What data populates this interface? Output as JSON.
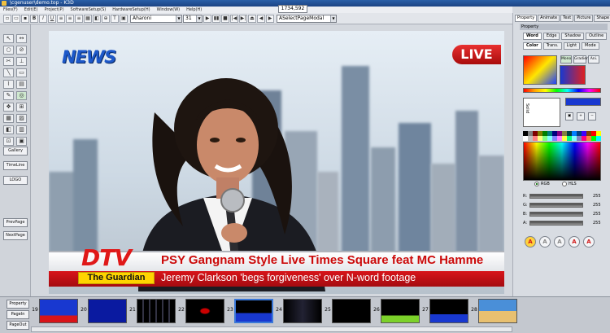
{
  "window": {
    "title": "\\cgenuser\\demo.top - K3D"
  },
  "coords_readout": "1734,592",
  "menu": [
    "Files(F)",
    "Edit(E)",
    "Project(P)",
    "SoftwareSetup(S)",
    "HardwareSetup(H)",
    "Window(W)",
    "Help(H)"
  ],
  "toolbar": {
    "font": "Aharoni",
    "font_size": "31",
    "page_mode": "ASelectPageModal",
    "buttons": [
      "▶",
      "▮▮",
      "■",
      "|◀",
      "▶|",
      "⏏",
      "◀",
      "▶"
    ]
  },
  "left_panel": {
    "tools": [
      "↖",
      "↔",
      "○",
      "⊘",
      "✂",
      "⊥",
      "╲",
      "▭",
      "⌇",
      "▤",
      "✎",
      "◎",
      "❖",
      "⊞",
      "▦",
      "▨",
      "◧",
      "▥",
      "⊡",
      "▣"
    ],
    "buttons": {
      "gallery": "Gallery",
      "timeline": "TimeLine",
      "logo": "LOGO",
      "prev_page": "PrevPage",
      "next_page": "NextPage"
    }
  },
  "stage": {
    "logo_text": "NEWS",
    "live_badge": "LIVE",
    "channel": "DTV",
    "headline": "PSY Gangnam Style Live Times Square feat MC Hamme",
    "source_tag": "The Guardian",
    "subline": "Jeremy Clarkson 'begs forgiveness' over N-word footage"
  },
  "right_panel": {
    "tabs": [
      "Property",
      "Animate",
      "Text",
      "Picture",
      "Shape"
    ],
    "section": "Property",
    "subtabs_row1": [
      "Word",
      "Edge",
      "Shadow",
      "Outline"
    ],
    "subtabs_row2": [
      "Color",
      "Trans.",
      "Light",
      "Mode"
    ],
    "mode_buttons": [
      "Mono",
      "Gradient",
      "Ani."
    ],
    "solid_label": "Solid",
    "color_modes": {
      "rgb": "RGB",
      "hls": "HLS"
    },
    "channels": [
      {
        "label": "R:",
        "value": "255"
      },
      {
        "label": "G:",
        "value": "255"
      },
      {
        "label": "B:",
        "value": "255"
      },
      {
        "label": "A:",
        "value": "255"
      }
    ],
    "style_buttons": [
      "A",
      "A",
      "A",
      "A",
      "A"
    ]
  },
  "page_strip": {
    "buttons": {
      "property": "Property",
      "page_in": "PageIn",
      "page_out": "PageOut"
    },
    "page_numbers": [
      "19",
      "20",
      "21",
      "22",
      "23",
      "24",
      "25",
      "26",
      "27",
      "28"
    ]
  },
  "colors": {
    "accent": "#e01818",
    "headline_red": "#cc0a0a",
    "ticker_red": "#d8141a",
    "news_blue": "#1d58c9",
    "tag_yellow": "#ffd400"
  }
}
